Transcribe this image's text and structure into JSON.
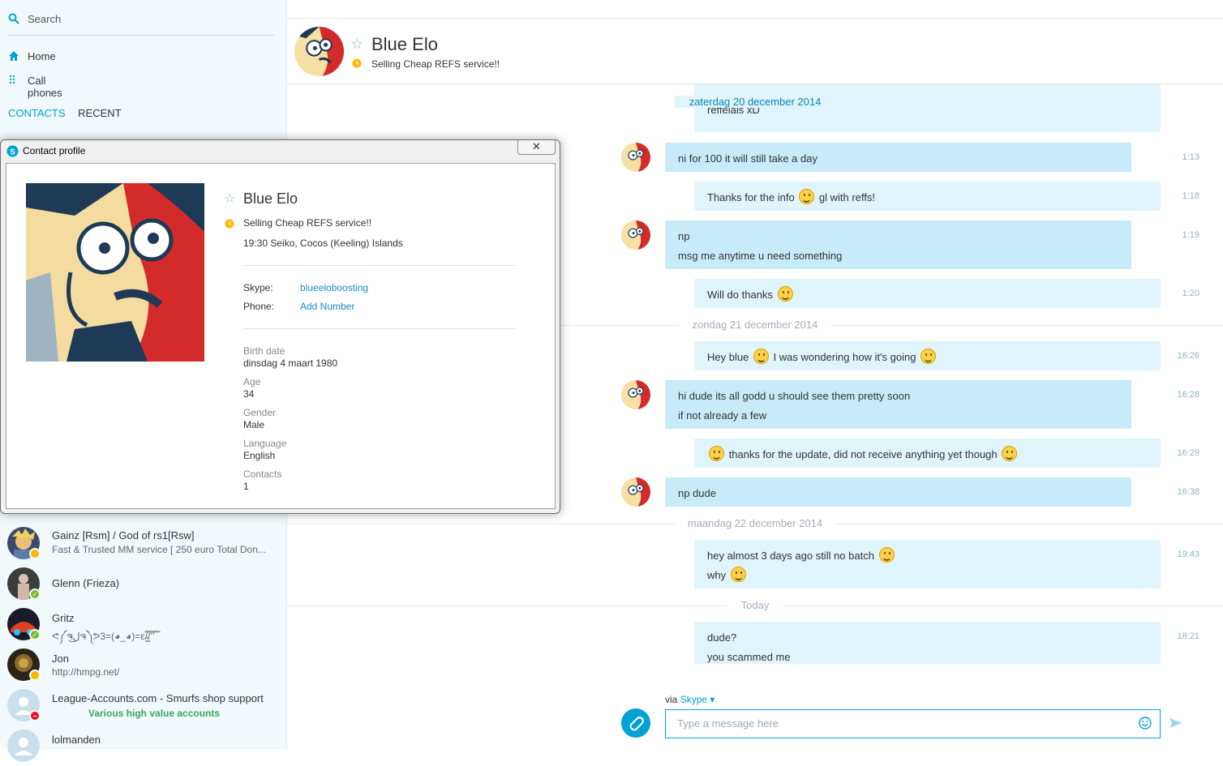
{
  "sidebar": {
    "search_label": "Search",
    "nav": [
      {
        "label": "Home",
        "icon": "home-icon"
      },
      {
        "label": "Call phones",
        "icon": "dialpad-icon"
      }
    ],
    "tabs": {
      "contacts": "CONTACTS",
      "recent": "RECENT"
    },
    "contacts": [
      {
        "name": "Gainz [Rsm] / God of rs1[Rsw]",
        "mood": "Fast & Trusted MM service [ 250 euro Total Don...",
        "status": "away"
      },
      {
        "name": "Glenn (Frieza)",
        "mood": "",
        "status": "online"
      },
      {
        "name": "Gritz",
        "mood": "ᕙ༼ຈل͜ຈ༽ᕗ3=(◕_◕)=ε/̵͇̿̿/’̿’̿ ̿",
        "status": "online"
      },
      {
        "name": "Jon",
        "mood": "http://hmpg.net/",
        "status": "away"
      },
      {
        "name": "League-Accounts.com - Smurfs shop support",
        "mood": "Various high value accounts",
        "status": "dnd"
      },
      {
        "name": "lolmanden",
        "mood": "",
        "status": "offline"
      }
    ]
  },
  "header": {
    "name": "Blue Elo",
    "mood": "Selling Cheap REFS service!!"
  },
  "conversation": {
    "days": [
      "zaterdag 20 december 2014",
      "zondag 21 december 2014",
      "maandag 22 december 2014",
      "Today"
    ],
    "partial_top_text": "reffelals xD",
    "messages": [
      {
        "from": "them",
        "lines": [
          "ni for 100 it will still take a day"
        ],
        "time": "1:13"
      },
      {
        "from": "me",
        "lines": [
          "Thanks for the info",
          "gl with reffs!"
        ],
        "time": "1:18"
      },
      {
        "from": "them",
        "lines": [
          "np",
          "msg me anytime u need something"
        ],
        "time": "1:19"
      },
      {
        "from": "me",
        "lines": [
          "Will do thanks"
        ],
        "time": "1:20"
      },
      {
        "from": "me",
        "lines": [
          "Hey blue",
          "I was wondering how it's going"
        ],
        "time": "16:26"
      },
      {
        "from": "them",
        "lines": [
          "hi dude its all godd u should see them pretty soon",
          "if not already a few"
        ],
        "time": "16:28"
      },
      {
        "from": "me",
        "lines": [
          "thanks for the update, did not receive anything yet though"
        ],
        "time": "16:29"
      },
      {
        "from": "them",
        "lines": [
          "np dude"
        ],
        "time": "16:38"
      },
      {
        "from": "me",
        "lines": [
          "hey almost 3 days ago still no batch",
          "why"
        ],
        "time": "19:43"
      },
      {
        "from": "me",
        "lines": [
          "dude?",
          "you scammed me"
        ],
        "time": "18:21"
      }
    ]
  },
  "compose": {
    "via_prefix": "via",
    "via_service": "Skype",
    "placeholder": "Type a message here"
  },
  "profile": {
    "title": "Contact profile",
    "close_glyph": "✕",
    "name": "Blue Elo",
    "mood": "Selling Cheap REFS service!!",
    "local_time": "19:30 Seiko, Cocos (Keeling) Islands",
    "skype_label": "Skype:",
    "skype_value": "blueeloboosting",
    "phone_label": "Phone:",
    "phone_value": "Add Number",
    "birth_label": "Birth date",
    "birth_value": "dinsdag 4 maart 1980",
    "age_label": "Age",
    "age_value": "34",
    "gender_label": "Gender",
    "gender_value": "Male",
    "language_label": "Language",
    "language_value": "English",
    "contacts_label": "Contacts",
    "contacts_value": "1"
  },
  "colors": {
    "accent": "#00a2d6",
    "bubble_them": "#c8ebfa",
    "bubble_me": "#e0f4fc",
    "status_online": "#7cb82f",
    "status_away": "#fbb900",
    "status_dnd": "#e81123"
  }
}
